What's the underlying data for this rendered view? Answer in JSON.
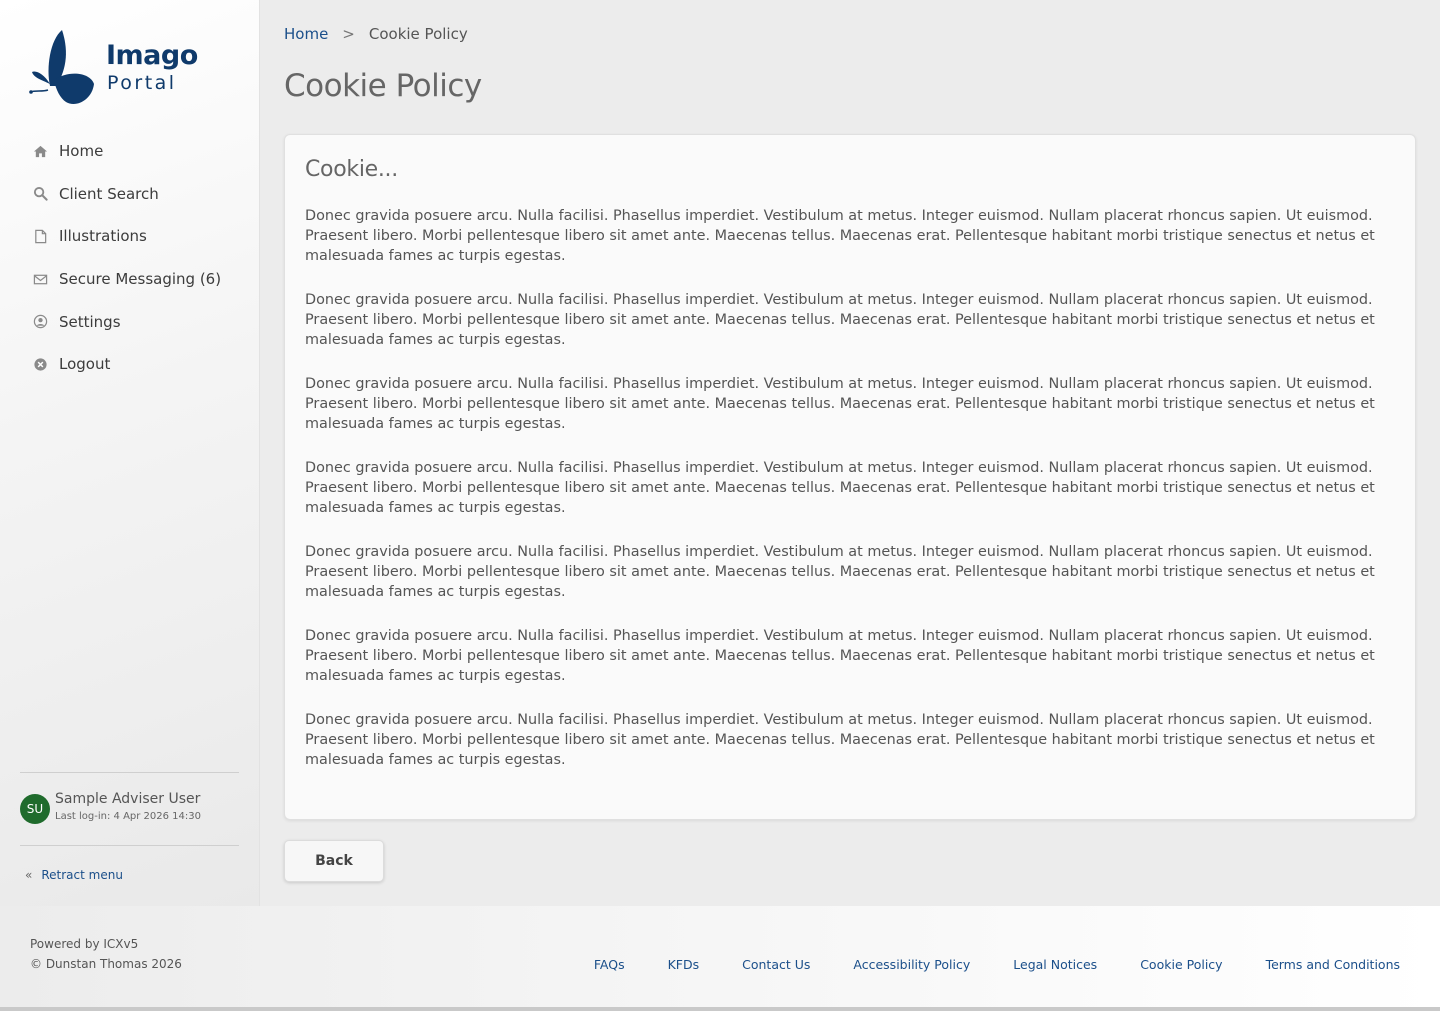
{
  "brand": {
    "name_line1": "Imago",
    "name_line2": "Portal",
    "logo_icon": "butterfly-icon",
    "color": "#0f3a6b"
  },
  "sidebar": {
    "items": [
      {
        "label": "Home",
        "icon": "home-icon"
      },
      {
        "label": "Client Search",
        "icon": "search-icon"
      },
      {
        "label": "Illustrations",
        "icon": "document-icon"
      },
      {
        "label": "Secure Messaging (6)",
        "icon": "envelope-icon"
      },
      {
        "label": "Settings",
        "icon": "user-circle-icon"
      },
      {
        "label": "Logout",
        "icon": "close-circle-icon"
      }
    ],
    "user": {
      "initials": "SU",
      "name": "Sample Adviser User",
      "last_login": "Last log-in: 4 Apr 2026 14:30"
    },
    "retract_label": "Retract menu"
  },
  "breadcrumb": {
    "home": "Home",
    "separator": ">",
    "current": "Cookie Policy"
  },
  "page": {
    "title": "Cookie Policy",
    "card_title": "Cookie...",
    "paragraphs": [
      "Donec gravida posuere arcu. Nulla facilisi. Phasellus imperdiet. Vestibulum at metus. Integer euismod. Nullam placerat rhoncus sapien. Ut euismod. Praesent libero. Morbi pellentesque libero sit amet ante. Maecenas tellus. Maecenas erat. Pellentesque habitant morbi tristique senectus et netus et malesuada fames ac turpis egestas.",
      "Donec gravida posuere arcu. Nulla facilisi. Phasellus imperdiet. Vestibulum at metus. Integer euismod. Nullam placerat rhoncus sapien. Ut euismod. Praesent libero. Morbi pellentesque libero sit amet ante. Maecenas tellus. Maecenas erat. Pellentesque habitant morbi tristique senectus et netus et malesuada fames ac turpis egestas.",
      "Donec gravida posuere arcu. Nulla facilisi. Phasellus imperdiet. Vestibulum at metus. Integer euismod. Nullam placerat rhoncus sapien. Ut euismod. Praesent libero. Morbi pellentesque libero sit amet ante. Maecenas tellus. Maecenas erat. Pellentesque habitant morbi tristique senectus et netus et malesuada fames ac turpis egestas.",
      "Donec gravida posuere arcu. Nulla facilisi. Phasellus imperdiet. Vestibulum at metus. Integer euismod. Nullam placerat rhoncus sapien. Ut euismod. Praesent libero. Morbi pellentesque libero sit amet ante. Maecenas tellus. Maecenas erat. Pellentesque habitant morbi tristique senectus et netus et malesuada fames ac turpis egestas.",
      "Donec gravida posuere arcu. Nulla facilisi. Phasellus imperdiet. Vestibulum at metus. Integer euismod. Nullam placerat rhoncus sapien. Ut euismod. Praesent libero. Morbi pellentesque libero sit amet ante. Maecenas tellus. Maecenas erat. Pellentesque habitant morbi tristique senectus et netus et malesuada fames ac turpis egestas.",
      "Donec gravida posuere arcu. Nulla facilisi. Phasellus imperdiet. Vestibulum at metus. Integer euismod. Nullam placerat rhoncus sapien. Ut euismod. Praesent libero. Morbi pellentesque libero sit amet ante. Maecenas tellus. Maecenas erat. Pellentesque habitant morbi tristique senectus et netus et malesuada fames ac turpis egestas.",
      "Donec gravida posuere arcu. Nulla facilisi. Phasellus imperdiet. Vestibulum at metus. Integer euismod. Nullam placerat rhoncus sapien. Ut euismod. Praesent libero. Morbi pellentesque libero sit amet ante. Maecenas tellus. Maecenas erat. Pellentesque habitant morbi tristique senectus et netus et malesuada fames ac turpis egestas."
    ],
    "back_label": "Back"
  },
  "footer": {
    "powered_by": "Powered by ICXv5",
    "copyright": "© Dunstan Thomas 2026",
    "links": [
      "FAQs",
      "KFDs",
      "Contact Us",
      "Accessibility Policy",
      "Legal Notices",
      "Cookie Policy",
      "Terms and Conditions"
    ]
  },
  "colors": {
    "link": "#1b4f8a",
    "avatar_bg": "#1f6b2c"
  }
}
